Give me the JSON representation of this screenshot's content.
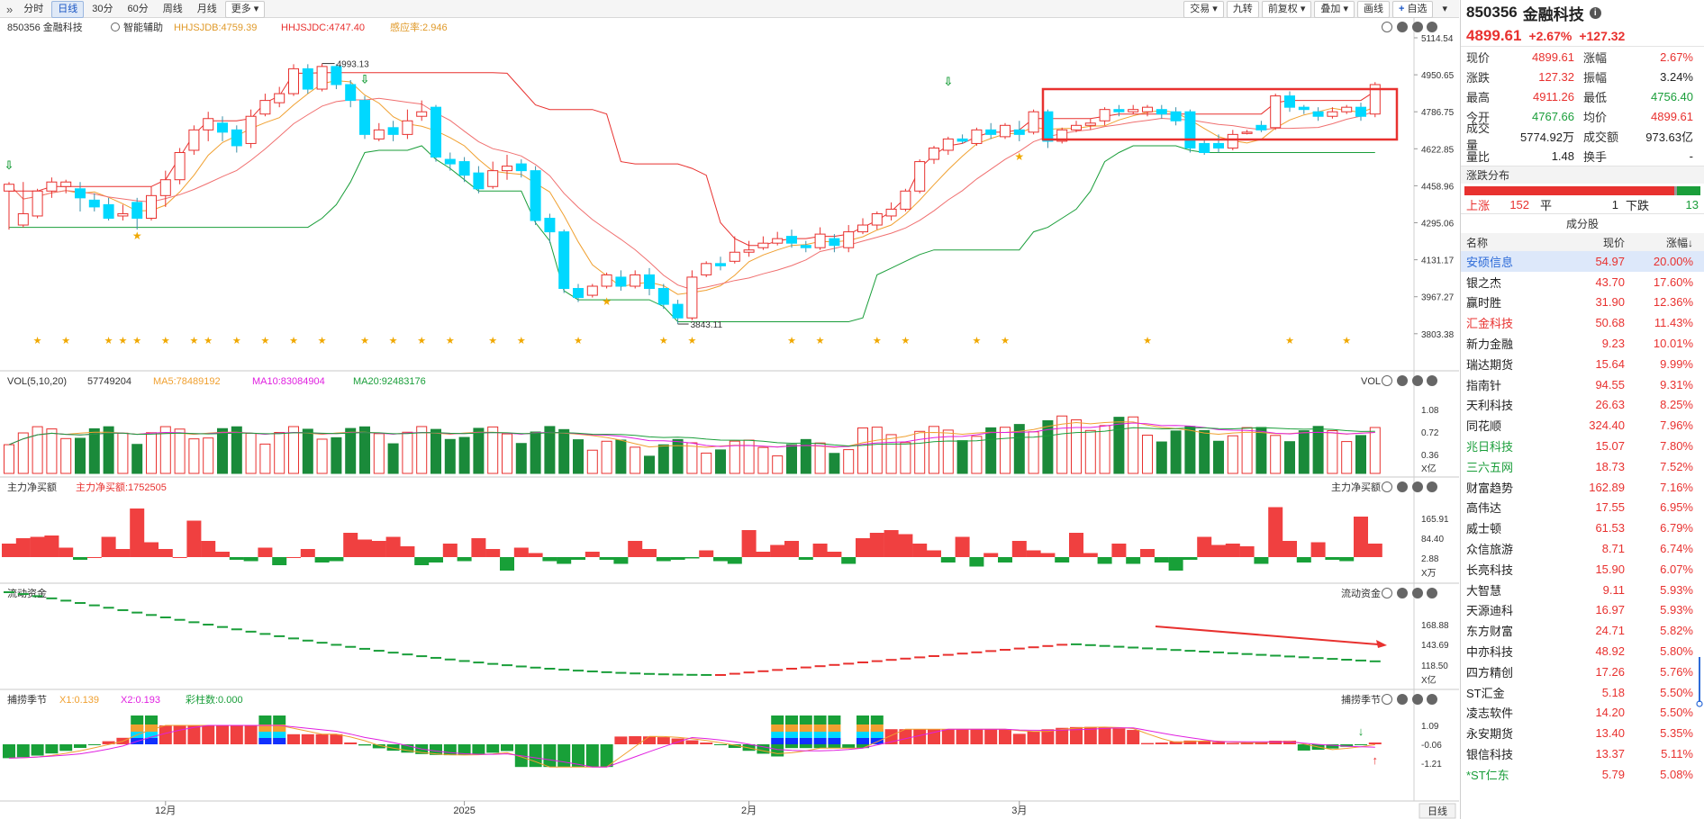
{
  "toolbar": {
    "expand_icon": "double-chevron-right",
    "left_buttons": [
      "分时",
      "日线",
      "30分",
      "60分",
      "周线",
      "月线",
      "更多"
    ],
    "active": "日线",
    "right_buttons": [
      "交易",
      "九转",
      "前复权",
      "叠加",
      "画线",
      "自选"
    ]
  },
  "panels": {
    "main": {
      "code_name": "850356 金融科技",
      "assist": "智能辅助",
      "ind1": "HHJSJDB:4759.39",
      "ind2": "HHJSJDC:4747.40",
      "ind3": "感应率:2.946",
      "axis_labels": [
        "5114.54",
        "4950.65",
        "4786.75",
        "4622.85",
        "4458.96",
        "4295.06",
        "4131.17",
        "3967.27",
        "3803.38"
      ],
      "high_label": "4993.13",
      "low_label": "3843.11"
    },
    "vol": {
      "title": "VOL(5,10,20)",
      "v": "57749204",
      "ma5": "MA5:78489192",
      "ma10": "MA10:83084904",
      "ma20": "MA20:92483176",
      "right_title": "VOL",
      "axis_labels": [
        "1.08",
        "0.72",
        "0.36",
        "X亿"
      ]
    },
    "net": {
      "title": "主力净买额",
      "value": "主力净买额:1752505",
      "right_title": "主力净买额",
      "axis_labels": [
        "165.91",
        "84.40",
        "2.88",
        "X万"
      ]
    },
    "flow": {
      "title": "流动资金",
      "right_title": "流动资金",
      "axis_labels": [
        "168.88",
        "143.69",
        "118.50",
        "X亿"
      ]
    },
    "season": {
      "title": "捕捞季节",
      "x1": "X1:0.139",
      "x2": "X2:0.193",
      "bars": "彩柱数:0.000",
      "right_title": "捕捞季节",
      "axis_labels": [
        "1.09",
        "-0.06",
        "-1.21"
      ]
    },
    "xaxis": {
      "labels": [
        "12月",
        "2025",
        "2月",
        "3月"
      ],
      "period": "日线"
    }
  },
  "quote": {
    "code": "850356",
    "name": "金融科技",
    "price": "4899.61",
    "pct": "+2.67%",
    "chg": "+127.32",
    "rows": [
      {
        "l": "现价",
        "v": "4899.61",
        "vc": "up",
        "l2": "涨幅",
        "v2": "2.67%",
        "v2c": "up"
      },
      {
        "l": "涨跌",
        "v": "127.32",
        "vc": "up",
        "l2": "振幅",
        "v2": "3.24%",
        "v2c": "blk"
      },
      {
        "l": "最高",
        "v": "4911.26",
        "vc": "up",
        "l2": "最低",
        "v2": "4756.40",
        "v2c": "dn"
      },
      {
        "l": "今开",
        "v": "4767.66",
        "vc": "dn",
        "l2": "均价",
        "v2": "4899.61",
        "v2c": "up"
      },
      {
        "l": "成交量",
        "v": "5774.92万",
        "vc": "blk",
        "l2": "成交额",
        "v2": "973.63亿",
        "v2c": "blk"
      },
      {
        "l": "量比",
        "v": "1.48",
        "vc": "blk",
        "l2": "换手",
        "v2": "-",
        "v2c": "blk"
      }
    ]
  },
  "distribution": {
    "title": "涨跌分布",
    "up_label": "上涨",
    "up": "152",
    "flat_label": "平",
    "flat": "1",
    "down_label": "下跌",
    "down": "13"
  },
  "constituents": {
    "title": "成分股",
    "headers": [
      "名称",
      "现价",
      "涨幅↓"
    ],
    "rows": [
      {
        "name": "安硕信息",
        "price": "54.97",
        "chg": "20.00%",
        "style": "blue",
        "sel": true
      },
      {
        "name": "银之杰",
        "price": "43.70",
        "chg": "17.60%",
        "style": ""
      },
      {
        "name": "赢时胜",
        "price": "31.90",
        "chg": "12.36%",
        "style": ""
      },
      {
        "name": "汇金科技",
        "price": "50.68",
        "chg": "11.43%",
        "style": "red"
      },
      {
        "name": "新力金融",
        "price": "9.23",
        "chg": "10.01%",
        "style": ""
      },
      {
        "name": "瑞达期货",
        "price": "15.64",
        "chg": "9.99%",
        "style": ""
      },
      {
        "name": "指南针",
        "price": "94.55",
        "chg": "9.31%",
        "style": ""
      },
      {
        "name": "天利科技",
        "price": "26.63",
        "chg": "8.25%",
        "style": ""
      },
      {
        "name": "同花顺",
        "price": "324.40",
        "chg": "7.96%",
        "style": ""
      },
      {
        "name": "兆日科技",
        "price": "15.07",
        "chg": "7.80%",
        "style": "green"
      },
      {
        "name": "三六五网",
        "price": "18.73",
        "chg": "7.52%",
        "style": "green"
      },
      {
        "name": "财富趋势",
        "price": "162.89",
        "chg": "7.16%",
        "style": ""
      },
      {
        "name": "高伟达",
        "price": "17.55",
        "chg": "6.95%",
        "style": ""
      },
      {
        "name": "威士顿",
        "price": "61.53",
        "chg": "6.79%",
        "style": ""
      },
      {
        "name": "众信旅游",
        "price": "8.71",
        "chg": "6.74%",
        "style": ""
      },
      {
        "name": "长亮科技",
        "price": "15.90",
        "chg": "6.07%",
        "style": ""
      },
      {
        "name": "大智慧",
        "price": "9.11",
        "chg": "5.93%",
        "style": ""
      },
      {
        "name": "天源迪科",
        "price": "16.97",
        "chg": "5.93%",
        "style": ""
      },
      {
        "name": "东方财富",
        "price": "24.71",
        "chg": "5.82%",
        "style": ""
      },
      {
        "name": "中亦科技",
        "price": "48.92",
        "chg": "5.80%",
        "style": ""
      },
      {
        "name": "四方精创",
        "price": "17.26",
        "chg": "5.76%",
        "style": ""
      },
      {
        "name": "ST汇金",
        "price": "5.18",
        "chg": "5.50%",
        "style": ""
      },
      {
        "name": "凌志软件",
        "price": "14.20",
        "chg": "5.50%",
        "style": ""
      },
      {
        "name": "永安期货",
        "price": "13.40",
        "chg": "5.35%",
        "style": ""
      },
      {
        "name": "银信科技",
        "price": "13.37",
        "chg": "5.11%",
        "style": ""
      },
      {
        "name": "*ST仁东",
        "price": "5.79",
        "chg": "5.08%",
        "style": "green"
      }
    ]
  },
  "colors": {
    "up": "#e8312f",
    "down_candle": "#00d8ff",
    "vol_down": "#1a8a3a",
    "ma5": "#f0a030",
    "ma10": "#e020e0",
    "ma20": "#1a9e3a",
    "highlight_box": "#e8312f"
  },
  "chart_data": {
    "type": "candlestick",
    "title": "850356 金融科技",
    "ylim": [
      3803.38,
      5114.54
    ],
    "candles": [
      [
        4430,
        4460,
        4260,
        4470
      ],
      [
        4280,
        4330,
        4270,
        4470
      ],
      [
        4320,
        4430,
        4310,
        4440
      ],
      [
        4430,
        4470,
        4400,
        4490
      ],
      [
        4450,
        4470,
        4420,
        4480
      ],
      [
        4440,
        4400,
        4340,
        4470
      ],
      [
        4390,
        4360,
        4340,
        4420
      ],
      [
        4370,
        4310,
        4300,
        4400
      ],
      [
        4320,
        4330,
        4300,
        4370
      ],
      [
        4380,
        4310,
        4260,
        4400
      ],
      [
        4310,
        4410,
        4300,
        4450
      ],
      [
        4410,
        4480,
        4360,
        4520
      ],
      [
        4480,
        4600,
        4460,
        4620
      ],
      [
        4610,
        4700,
        4590,
        4720
      ],
      [
        4700,
        4750,
        4650,
        4780
      ],
      [
        4730,
        4690,
        4650,
        4760
      ],
      [
        4700,
        4630,
        4600,
        4720
      ],
      [
        4640,
        4760,
        4620,
        4790
      ],
      [
        4770,
        4830,
        4760,
        4860
      ],
      [
        4820,
        4860,
        4800,
        4890
      ],
      [
        4860,
        4970,
        4850,
        4990
      ],
      [
        4970,
        4880,
        4860,
        4990
      ],
      [
        4880,
        4980,
        4870,
        4993
      ],
      [
        4980,
        4900,
        4880,
        4990
      ],
      [
        4900,
        4830,
        4800,
        4920
      ],
      [
        4830,
        4680,
        4660,
        4850
      ],
      [
        4660,
        4700,
        4650,
        4730
      ],
      [
        4710,
        4680,
        4650,
        4740
      ],
      [
        4680,
        4740,
        4660,
        4790
      ],
      [
        4760,
        4780,
        4740,
        4830
      ],
      [
        4800,
        4580,
        4560,
        4810
      ],
      [
        4570,
        4550,
        4520,
        4600
      ],
      [
        4560,
        4500,
        4470,
        4580
      ],
      [
        4510,
        4440,
        4420,
        4540
      ],
      [
        4450,
        4520,
        4440,
        4560
      ],
      [
        4520,
        4540,
        4480,
        4590
      ],
      [
        4550,
        4520,
        4490,
        4570
      ],
      [
        4520,
        4300,
        4280,
        4540
      ],
      [
        4310,
        4250,
        4200,
        4330
      ],
      [
        4250,
        4000,
        3980,
        4260
      ],
      [
        4000,
        3960,
        3940,
        4020
      ],
      [
        3970,
        4010,
        3960,
        4020
      ],
      [
        4010,
        4060,
        4000,
        4070
      ],
      [
        4050,
        4010,
        3990,
        4080
      ],
      [
        4010,
        4060,
        4000,
        4080
      ],
      [
        4060,
        4000,
        3970,
        4090
      ],
      [
        4000,
        3930,
        3910,
        4020
      ],
      [
        3930,
        3870,
        3843,
        3950
      ],
      [
        3870,
        4050,
        3860,
        4080
      ],
      [
        4060,
        4110,
        4050,
        4120
      ],
      [
        4110,
        4100,
        4080,
        4140
      ],
      [
        4120,
        4160,
        4110,
        4230
      ],
      [
        4160,
        4170,
        4140,
        4210
      ],
      [
        4180,
        4200,
        4170,
        4230
      ],
      [
        4200,
        4220,
        4190,
        4250
      ],
      [
        4230,
        4200,
        4180,
        4260
      ],
      [
        4190,
        4180,
        4160,
        4210
      ],
      [
        4180,
        4240,
        4170,
        4270
      ],
      [
        4220,
        4190,
        4160,
        4240
      ],
      [
        4180,
        4250,
        4160,
        4280
      ],
      [
        4250,
        4280,
        4240,
        4310
      ],
      [
        4280,
        4330,
        4260,
        4340
      ],
      [
        4320,
        4350,
        4300,
        4380
      ],
      [
        4350,
        4430,
        4340,
        4440
      ],
      [
        4430,
        4560,
        4420,
        4570
      ],
      [
        4570,
        4620,
        4550,
        4630
      ],
      [
        4610,
        4660,
        4590,
        4670
      ],
      [
        4660,
        4650,
        4640,
        4680
      ],
      [
        4640,
        4700,
        4630,
        4710
      ],
      [
        4700,
        4680,
        4660,
        4730
      ],
      [
        4670,
        4720,
        4660,
        4730
      ],
      [
        4700,
        4680,
        4650,
        4740
      ],
      [
        4690,
        4780,
        4680,
        4790
      ],
      [
        4780,
        4650,
        4620,
        4790
      ],
      [
        4650,
        4700,
        4640,
        4710
      ],
      [
        4700,
        4720,
        4690,
        4740
      ],
      [
        4720,
        4730,
        4700,
        4750
      ],
      [
        4740,
        4790,
        4720,
        4800
      ],
      [
        4790,
        4780,
        4760,
        4810
      ],
      [
        4780,
        4790,
        4770,
        4810
      ],
      [
        4780,
        4800,
        4760,
        4810
      ],
      [
        4790,
        4770,
        4750,
        4810
      ],
      [
        4780,
        4740,
        4720,
        4800
      ],
      [
        4780,
        4620,
        4600,
        4790
      ],
      [
        4640,
        4600,
        4590,
        4660
      ],
      [
        4640,
        4620,
        4600,
        4680
      ],
      [
        4620,
        4680,
        4610,
        4700
      ],
      [
        4690,
        4690,
        4680,
        4700
      ],
      [
        4720,
        4700,
        4690,
        4740
      ],
      [
        4710,
        4850,
        4700,
        4860
      ],
      [
        4850,
        4800,
        4780,
        4870
      ],
      [
        4800,
        4790,
        4770,
        4810
      ],
      [
        4780,
        4760,
        4740,
        4800
      ],
      [
        4760,
        4780,
        4750,
        4800
      ],
      [
        4780,
        4800,
        4770,
        4810
      ],
      [
        4800,
        4760,
        4740,
        4820
      ],
      [
        4770,
        4900,
        4756,
        4911
      ]
    ]
  }
}
